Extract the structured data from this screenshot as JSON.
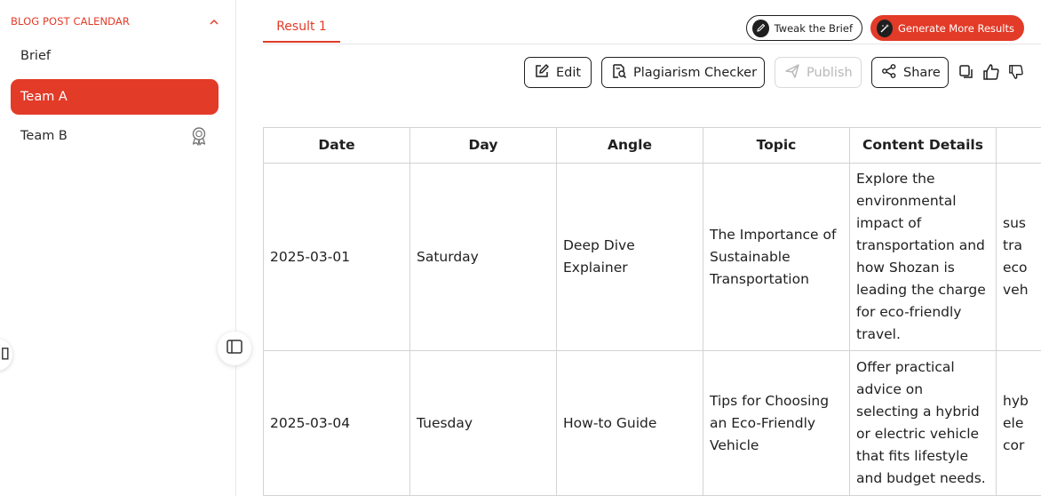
{
  "sidebar": {
    "section_title": "BLOG POST CALENDAR",
    "items": [
      {
        "label": "Brief"
      },
      {
        "label": "Team A",
        "active": true
      },
      {
        "label": "Team B",
        "icon": "award-badge-icon"
      }
    ]
  },
  "tabs": [
    {
      "label": "Result 1",
      "active": true
    }
  ],
  "actions": {
    "tweak": "Tweak the Brief",
    "generate": "Generate More Results"
  },
  "toolbar": {
    "edit": "Edit",
    "plagiarism": "Plagiarism Checker",
    "publish": "Publish",
    "share": "Share"
  },
  "colors": {
    "accent": "#e23b28",
    "text": "#1f1f1f",
    "border": "#d3d3d3"
  },
  "table": {
    "headers": [
      "Date",
      "Day",
      "Angle",
      "Topic",
      "Content Details",
      ""
    ],
    "rows": [
      {
        "date": "2025-03-01",
        "day": "Saturday",
        "angle": [
          "Deep Dive",
          "Explainer"
        ],
        "topic": [
          "The Importance of",
          "Sustainable",
          "Transportation"
        ],
        "details": [
          "Explore the",
          "environmental",
          "impact of",
          "transportation and",
          "how Shozan is",
          "leading the charge",
          "for eco-friendly",
          "travel."
        ],
        "extra": [
          "sus",
          "tra",
          "eco",
          "veh"
        ]
      },
      {
        "date": "2025-03-04",
        "day": "Tuesday",
        "angle": [
          "How-to Guide"
        ],
        "topic": [
          "Tips for Choosing",
          "an Eco-Friendly",
          "Vehicle"
        ],
        "details": [
          "Offer practical",
          "advice on",
          "selecting a hybrid",
          "or electric vehicle",
          "that fits lifestyle",
          "and budget needs."
        ],
        "extra": [
          "hyb",
          "ele",
          "cor"
        ]
      }
    ]
  }
}
